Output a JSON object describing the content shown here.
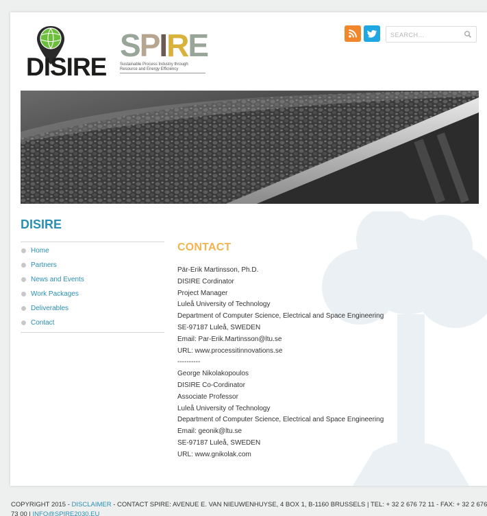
{
  "header": {
    "logo_disire_text": "DISIRE",
    "logo_spire_letters": [
      "S",
      "P",
      "I",
      "R",
      "E"
    ],
    "logo_spire_tagline_1": "Sustainable Process Industry through",
    "logo_spire_tagline_2": "Resource and Energy Efficiency",
    "search_placeholder": "SEARCH..."
  },
  "icons": {
    "rss": "rss-icon",
    "twitter": "twitter-icon",
    "search": "search-icon"
  },
  "colors": {
    "accent_blue": "#2a8fb0",
    "accent_orange": "#f0b450",
    "rss": "#f0882b",
    "twitter": "#1ea7e0"
  },
  "section_title": "DISIRE",
  "sidenav": {
    "items": [
      {
        "label": "Home"
      },
      {
        "label": "Partners"
      },
      {
        "label": "News and Events"
      },
      {
        "label": "Work Packages"
      },
      {
        "label": "Deliverables"
      },
      {
        "label": "Contact"
      }
    ]
  },
  "content": {
    "heading": "CONTACT",
    "lines": [
      "Pär-Erik Martinsson, Ph.D.",
      "DISIRE Cordinator",
      "Project Manager",
      "Luleå University of Technology",
      "Department of Computer Science, Electrical and Space Engineering",
      "SE-97187 Luleå, SWEDEN",
      "Email: Par-Erik.Martinsson@ltu.se",
      "URL: www.processitinnovations.se",
      "----------",
      "George Nikolakopoulos",
      "DISIRE Co-Cordinator",
      "Associate Professor",
      "Luleå University of Technology",
      "Department of Computer Science, Electrical and Space Engineering",
      "Email: geonik@ltu.se",
      "SE-97187 Luleå, SWEDEN",
      "URL: www.gnikolak.com"
    ]
  },
  "footer": {
    "copyright": "COPYRIGHT 2015 - ",
    "disclaimer": "DISCLAIMER",
    "contact_text": " - CONTACT SPIRE: AVENUE E. VAN NIEUWENHUYSE, 4 BOX 1, B-1160 BRUSSELS | TEL: + 32 2 676 72 11 - FAX: + 32 2 676 73 00 | ",
    "email": "INFO@SPIRE2030.EU"
  }
}
